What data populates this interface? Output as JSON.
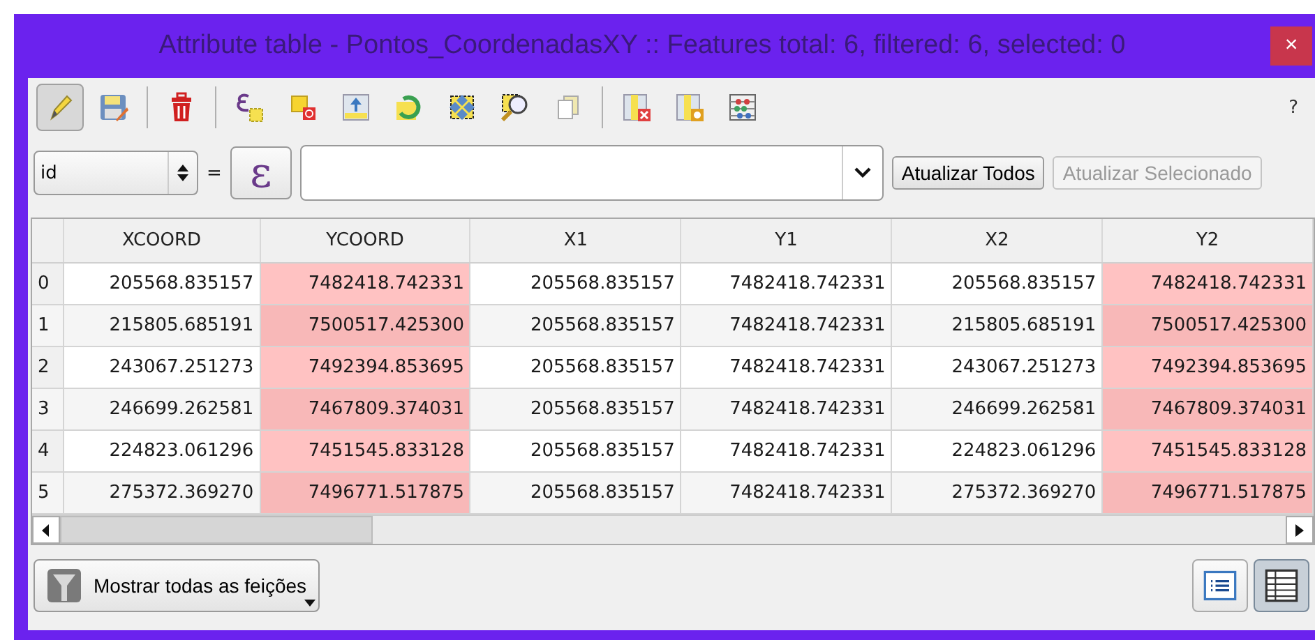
{
  "window": {
    "title": "Attribute table - Pontos_CoordenadasXY :: Features total: 6, filtered: 6, selected: 0",
    "close": "×"
  },
  "toolbar": {
    "groups": [
      [
        {
          "kind": "pencil",
          "selected": true
        },
        {
          "kind": "save",
          "selected": false
        }
      ],
      [
        {
          "kind": "trash",
          "selected": false
        }
      ],
      [
        {
          "kind": "expr-select",
          "selected": false
        },
        {
          "kind": "deselect",
          "selected": false
        },
        {
          "kind": "move-top",
          "selected": false
        },
        {
          "kind": "invert",
          "selected": false
        },
        {
          "kind": "pan",
          "selected": false
        },
        {
          "kind": "zoom",
          "selected": false
        },
        {
          "kind": "copy",
          "selected": false
        }
      ],
      [
        {
          "kind": "del-col",
          "selected": false
        },
        {
          "kind": "new-col",
          "selected": false
        },
        {
          "kind": "calc",
          "selected": false
        }
      ]
    ],
    "help": "?"
  },
  "filter": {
    "field": "id",
    "equals": "=",
    "expr_symbol": "ε",
    "update_all": "Atualizar Todos",
    "update_selected": "Atualizar Selecionado",
    "update_selected_disabled": true
  },
  "table": {
    "columns": [
      {
        "name": "XCOORD",
        "highlighted": false
      },
      {
        "name": "YCOORD",
        "highlighted": true
      },
      {
        "name": "X1",
        "highlighted": false
      },
      {
        "name": "Y1",
        "highlighted": false
      },
      {
        "name": "X2",
        "highlighted": false
      },
      {
        "name": "Y2",
        "highlighted": true
      }
    ],
    "rows": [
      {
        "header": "0",
        "cells": [
          "205568.835157",
          "7482418.742331",
          "205568.835157",
          "7482418.742331",
          "205568.835157",
          "7482418.742331"
        ]
      },
      {
        "header": "1",
        "cells": [
          "215805.685191",
          "7500517.425300",
          "205568.835157",
          "7482418.742331",
          "215805.685191",
          "7500517.425300"
        ]
      },
      {
        "header": "2",
        "cells": [
          "243067.251273",
          "7492394.853695",
          "205568.835157",
          "7482418.742331",
          "243067.251273",
          "7492394.853695"
        ]
      },
      {
        "header": "3",
        "cells": [
          "246699.262581",
          "7467809.374031",
          "205568.835157",
          "7482418.742331",
          "246699.262581",
          "7467809.374031"
        ]
      },
      {
        "header": "4",
        "cells": [
          "224823.061296",
          "7451545.833128",
          "205568.835157",
          "7482418.742331",
          "224823.061296",
          "7451545.833128"
        ]
      },
      {
        "header": "5",
        "cells": [
          "275372.369270",
          "7496771.517875",
          "205568.835157",
          "7482418.742331",
          "275372.369270",
          "7496771.517875"
        ]
      }
    ]
  },
  "footer": {
    "filter_button": "Mostrar todas as feições",
    "views": [
      {
        "kind": "form",
        "selected": false
      },
      {
        "kind": "table",
        "selected": true
      }
    ]
  }
}
